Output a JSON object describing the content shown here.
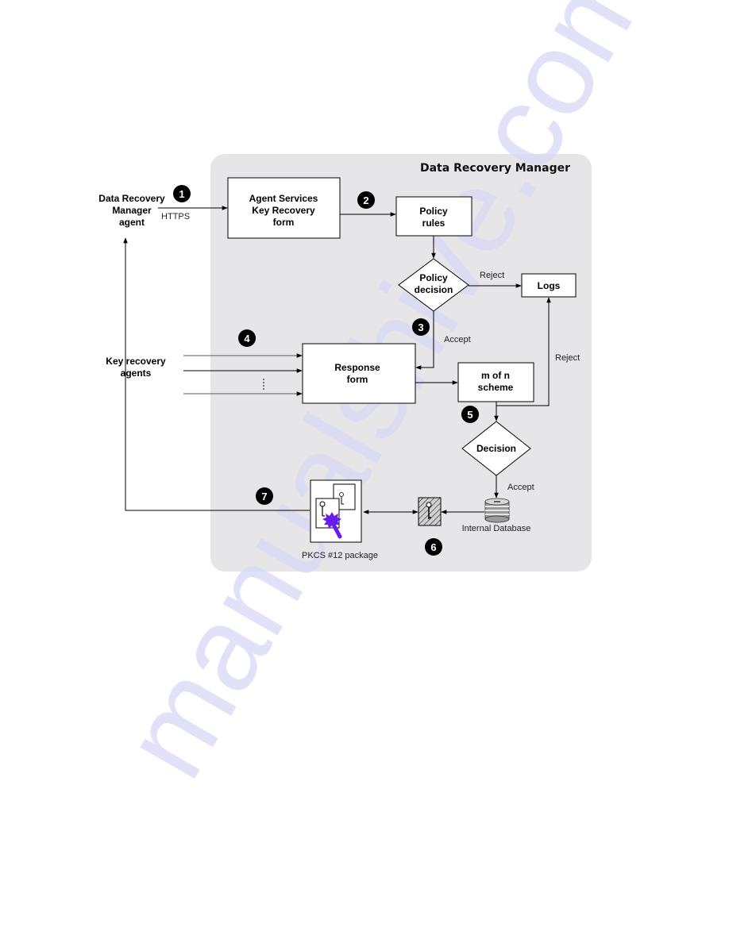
{
  "diagram": {
    "container_title": "Data Recovery Manager",
    "colors": {
      "container_fill": "#e6e6e8",
      "box_fill": "#ffffff",
      "stroke": "#000000",
      "badge_fill": "#000000",
      "seal_purple": "#6a1cf0",
      "watermark": "#d8d8f6"
    },
    "external_actors": {
      "drm_agent": [
        "Data Recovery",
        "Manager",
        "agent"
      ],
      "key_recovery_agents": [
        "Key recovery",
        "agents"
      ]
    },
    "nodes": {
      "agent_services": [
        "Agent Services",
        "Key Recovery",
        "form"
      ],
      "policy_rules": [
        "Policy",
        "rules"
      ],
      "policy_decision": [
        "Policy",
        "decision"
      ],
      "logs": [
        "Logs"
      ],
      "response_form": [
        "Response",
        "form"
      ],
      "m_of_n": [
        "m of n",
        "scheme"
      ],
      "decision": [
        "Decision"
      ],
      "internal_database": "Internal Database",
      "pkcs12": "PKCS #12 package"
    },
    "edge_labels": {
      "https": "HTTPS",
      "reject_policy": "Reject",
      "accept_policy": "Accept",
      "reject_mofn": "Reject",
      "accept_decision": "Accept"
    },
    "steps": [
      "1",
      "2",
      "3",
      "4",
      "5",
      "6",
      "7"
    ],
    "watermark": "manualshive.com"
  }
}
